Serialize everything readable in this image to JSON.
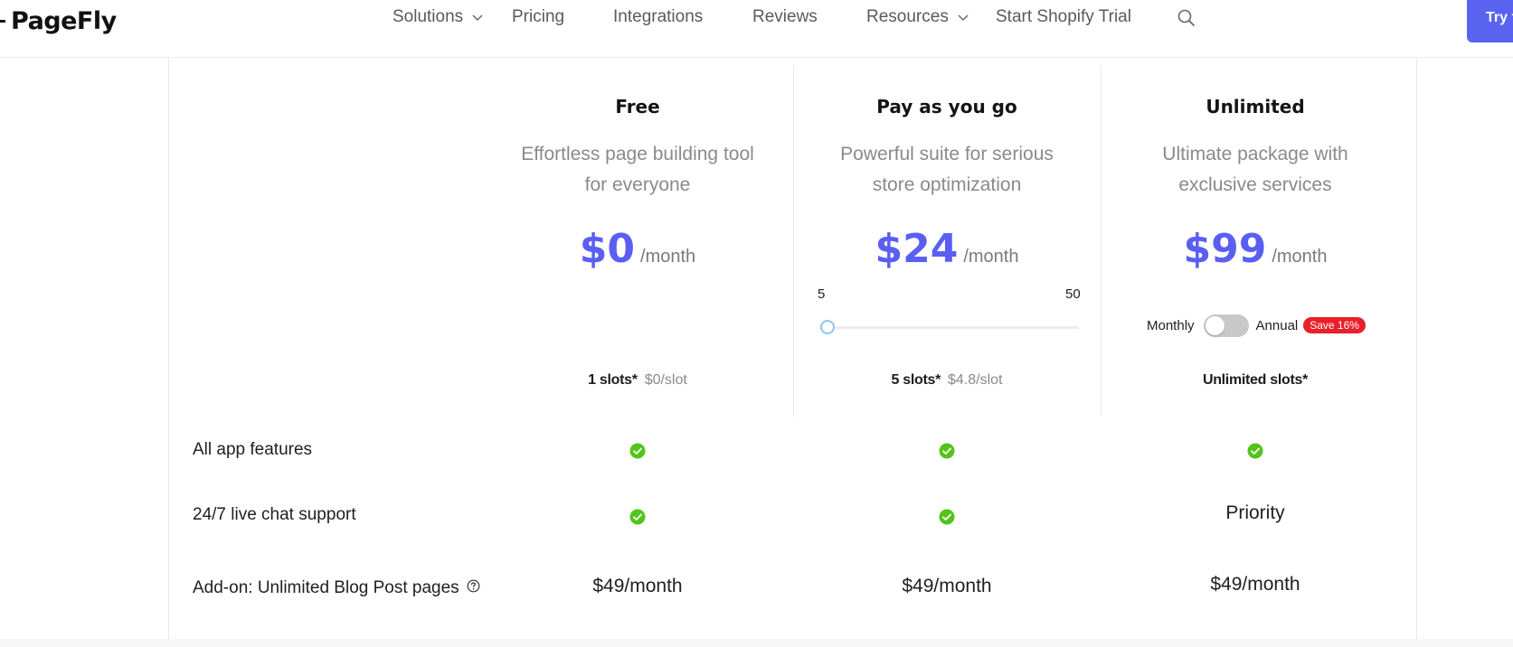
{
  "brand": {
    "name": "PageFly"
  },
  "nav": {
    "items": [
      {
        "label": "Solutions",
        "dropdown": true
      },
      {
        "label": "Pricing",
        "dropdown": false
      },
      {
        "label": "Integrations",
        "dropdown": false
      },
      {
        "label": "Reviews",
        "dropdown": false
      },
      {
        "label": "Resources",
        "dropdown": true
      },
      {
        "label": "Start Shopify Trial",
        "dropdown": false
      }
    ],
    "search_icon": "search-icon",
    "cta_label": "Try f"
  },
  "plans": [
    {
      "name": "Free",
      "description_line1": "Effortless page building tool",
      "description_line2": "for everyone",
      "price": "$0",
      "period": "/month",
      "slots": "1 slots*",
      "rate": "$0/slot"
    },
    {
      "name": "Pay as you go",
      "description_line1": "Powerful suite for serious",
      "description_line2": "store optimization",
      "price": "$24",
      "period": "/month",
      "slots": "5 slots*",
      "rate": "$4.8/slot",
      "slider": {
        "min": "5",
        "max": "50",
        "value": 5
      }
    },
    {
      "name": "Unlimited",
      "description_line1": "Ultimate package with",
      "description_line2": "exclusive services",
      "price": "$99",
      "period": "/month",
      "slots": "Unlimited slots*",
      "rate": "",
      "billing": {
        "monthly_label": "Monthly",
        "annual_label": "Annual",
        "annual_selected": false,
        "save_badge": "Save 16%"
      }
    }
  ],
  "features": [
    {
      "label": "All app features",
      "values": [
        "check",
        "check",
        "check"
      ]
    },
    {
      "label": "24/7 live chat support",
      "values": [
        "check",
        "check",
        "Priority"
      ]
    },
    {
      "label": "Add-on: Unlimited Blog Post pages",
      "values": [
        "$49/month",
        "$49/month",
        "$49/month"
      ],
      "help_icon": "question-circle-icon"
    }
  ],
  "colors": {
    "accent": "#5a5ff2",
    "check": "#52c41a",
    "badge": "#e8202a",
    "cta": "#5a63f0"
  }
}
